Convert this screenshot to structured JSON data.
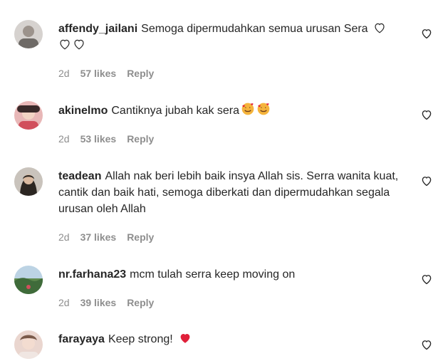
{
  "comments": [
    {
      "username": "affendy_jailani",
      "text": "Semoga dipermudahkan semua urusan Sera",
      "age": "2d",
      "likes": "57 likes",
      "reply": "Reply",
      "avatar_color": "#b8b2ad"
    },
    {
      "username": "akinelmo",
      "text": "Cantiknya jubah kak sera",
      "age": "2d",
      "likes": "53 likes",
      "reply": "Reply",
      "avatar_color": "#c97a7a"
    },
    {
      "username": "teadean",
      "text": "Allah nak beri lebih baik insya Allah sis. Serra wanita kuat, cantik dan baik hati, semoga diberkati dan dipermudahkan segala urusan oleh Allah",
      "age": "2d",
      "likes": "37 likes",
      "reply": "Reply",
      "avatar_color": "#8a8178"
    },
    {
      "username": "nr.farhana23",
      "text": "mcm tulah serra keep moving on",
      "age": "2d",
      "likes": "39 likes",
      "reply": "Reply",
      "avatar_color": "#7fa06e"
    },
    {
      "username": "farayaya",
      "text": "Keep strong!",
      "age": "",
      "likes": "",
      "reply": "",
      "avatar_color": "#d9b9b0"
    }
  ],
  "colors": {
    "text": "#262626",
    "meta": "#8e8e8e",
    "red_heart": "#e0203a",
    "emoji_face": "#f5b43c"
  }
}
